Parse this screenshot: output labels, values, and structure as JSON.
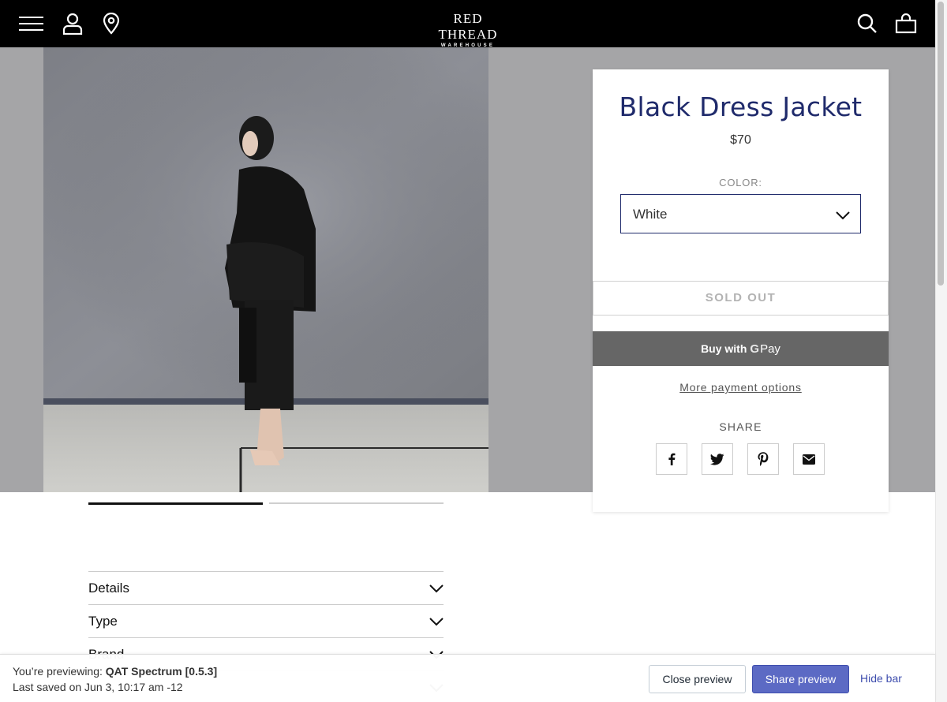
{
  "header": {
    "logo_line1": "RED THREAD",
    "logo_line2": "WAREHOUSE",
    "icons": [
      "menu-icon",
      "account-icon",
      "location-icon",
      "search-icon",
      "cart-icon"
    ]
  },
  "product": {
    "title": "Black Dress Jacket",
    "price": "$70",
    "color_label": "COLOR:",
    "color_value": "White",
    "soldout_label": "SOLD OUT",
    "gpay_label": "Buy with",
    "gpay_pay": "Pay",
    "more_payment": "More payment options",
    "share_label": "SHARE",
    "share_icons": [
      "facebook-icon",
      "twitter-icon",
      "pinterest-icon",
      "email-icon"
    ]
  },
  "gallery": {
    "slides": 2,
    "active_slide": 1
  },
  "accordion": {
    "items": [
      "Details",
      "Type",
      "Brand"
    ]
  },
  "preview_bar": {
    "previewing_prefix": "You’re previewing: ",
    "theme_name": "QAT Spectrum [0.5.3]",
    "last_saved": "Last saved on Jun 3, 10:17 am -12",
    "close_label": "Close preview",
    "share_label": "Share preview",
    "hide_label": "Hide bar"
  },
  "colors": {
    "title": "#1f2a6b",
    "share_button": "#5c6ac4",
    "header_bg": "#000000"
  }
}
